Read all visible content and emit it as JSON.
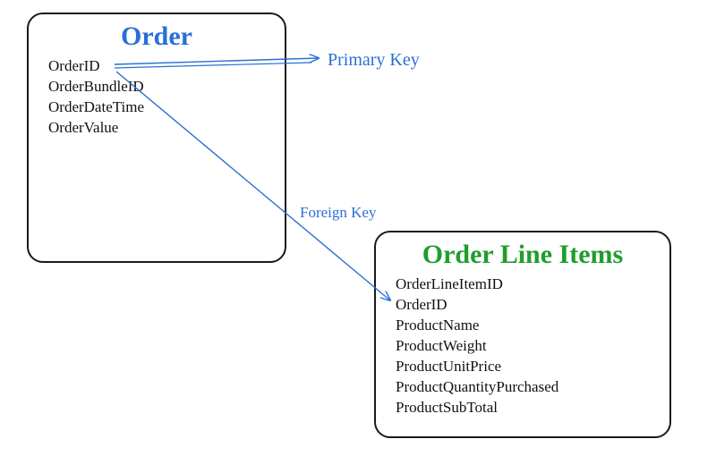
{
  "entities": {
    "order": {
      "title": "Order",
      "fields": [
        "OrderID",
        "OrderBundleID",
        "OrderDateTime",
        "OrderValue"
      ]
    },
    "orderLineItems": {
      "title": "Order Line Items",
      "fields": [
        "OrderLineItemID",
        "OrderID",
        "ProductName",
        "ProductWeight",
        "ProductUnitPrice",
        "ProductQuantityPurchased",
        "ProductSubTotal"
      ]
    }
  },
  "labels": {
    "primaryKey": "Primary Key",
    "foreignKey": "Foreign Key"
  },
  "colors": {
    "blue": "#2a6fd6",
    "green": "#1f9d2d",
    "ink": "#1a1a1a"
  }
}
